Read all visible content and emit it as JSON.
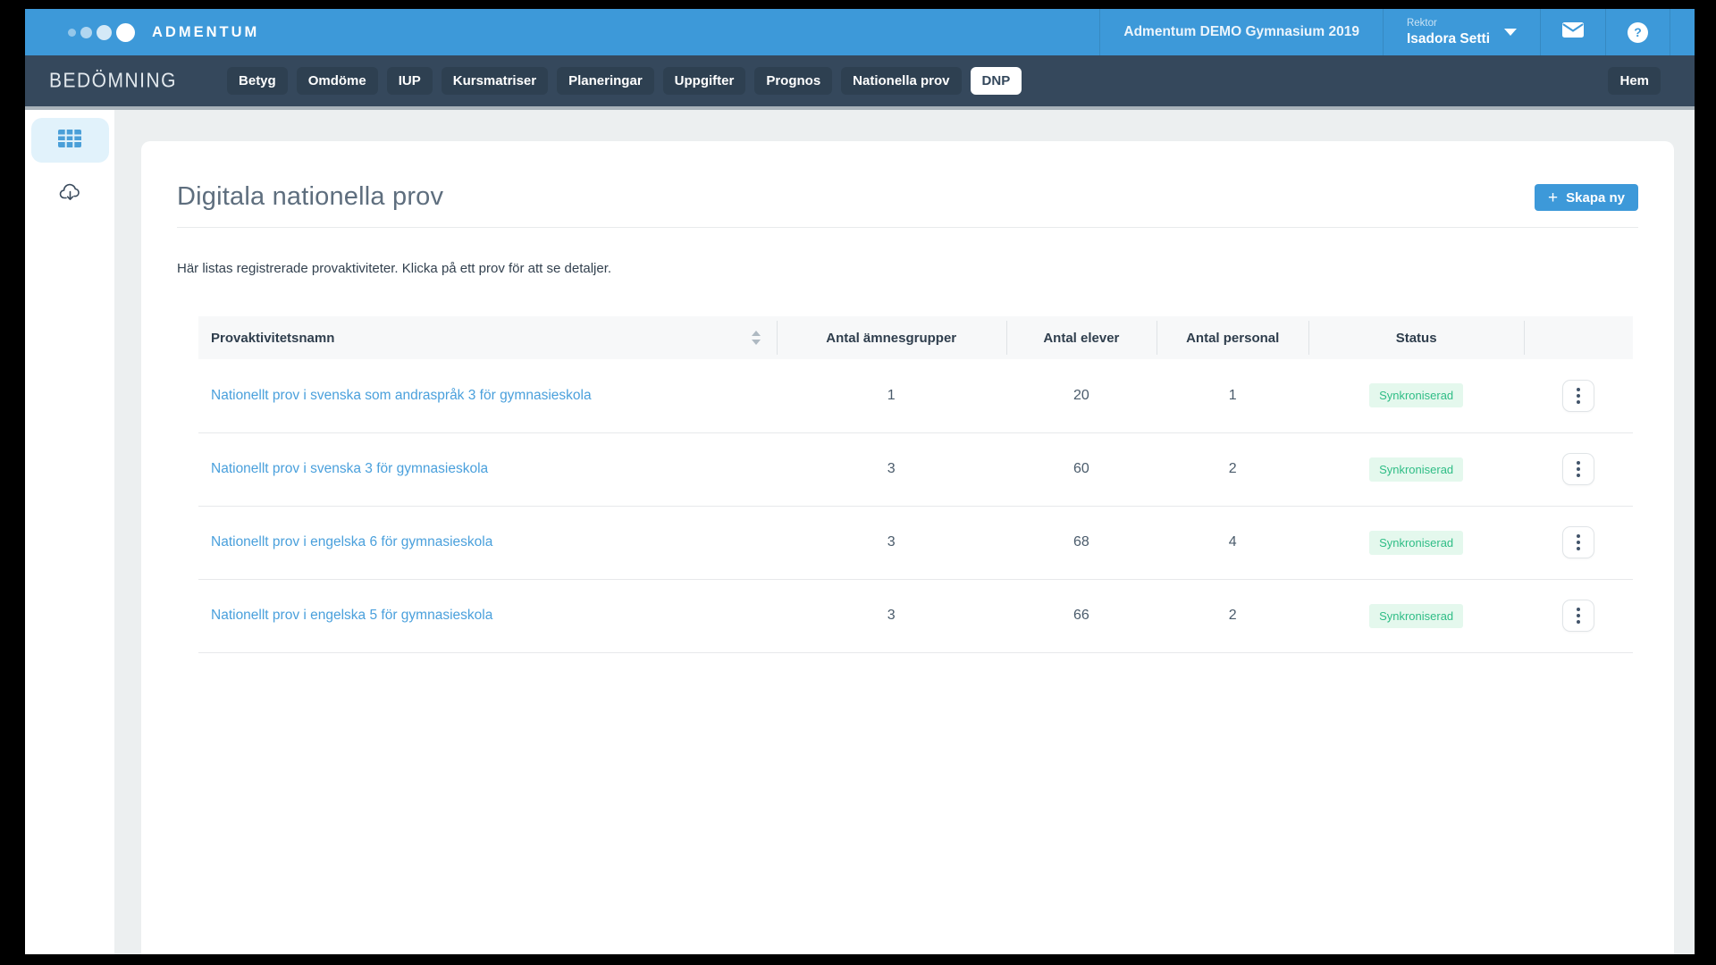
{
  "topbar": {
    "brand": "ADMENTUM",
    "school": "Admentum DEMO Gymnasium 2019",
    "user_role": "Rektor",
    "user_name": "Isadora Setti",
    "help_glyph": "?"
  },
  "nav": {
    "section": "BEDÖMNING",
    "tabs": [
      {
        "label": "Betyg",
        "active": false
      },
      {
        "label": "Omdöme",
        "active": false
      },
      {
        "label": "IUP",
        "active": false
      },
      {
        "label": "Kursmatriser",
        "active": false
      },
      {
        "label": "Planeringar",
        "active": false
      },
      {
        "label": "Uppgifter",
        "active": false
      },
      {
        "label": "Prognos",
        "active": false
      },
      {
        "label": "Nationella prov",
        "active": false
      },
      {
        "label": "DNP",
        "active": true
      }
    ],
    "home_label": "Hem"
  },
  "sidebar": {
    "items": [
      {
        "icon": "table-grid-icon",
        "active": true
      },
      {
        "icon": "cloud-download-icon",
        "active": false
      }
    ]
  },
  "main": {
    "title": "Digitala nationella prov",
    "create_label": "Skapa ny",
    "plus_glyph": "+",
    "description": "Här listas registrerade provaktiviteter. Klicka på ett prov för att se detaljer.",
    "table": {
      "columns": [
        "Provaktivitetsnamn",
        "Antal ämnesgrupper",
        "Antal elever",
        "Antal personal",
        "Status"
      ],
      "rows": [
        {
          "name": "Nationellt prov i svenska som andraspråk 3 för gymnasieskola",
          "groups": "1",
          "students": "20",
          "staff": "1",
          "status": "Synkroniserad"
        },
        {
          "name": "Nationellt prov i svenska 3 för gymnasieskola",
          "groups": "3",
          "students": "60",
          "staff": "2",
          "status": "Synkroniserad"
        },
        {
          "name": "Nationellt prov i engelska 6 för gymnasieskola",
          "groups": "3",
          "students": "68",
          "staff": "4",
          "status": "Synkroniserad"
        },
        {
          "name": "Nationellt prov i engelska 5 för gymnasieskola",
          "groups": "3",
          "students": "66",
          "staff": "2",
          "status": "Synkroniserad"
        }
      ]
    }
  },
  "colors": {
    "brand_blue": "#3d99d9",
    "navbar_navy": "#35485c",
    "link_blue": "#4aa0dc",
    "status_green_text": "#2fbd86",
    "status_green_bg": "#e4f8ed",
    "page_bg": "#eceff0"
  }
}
